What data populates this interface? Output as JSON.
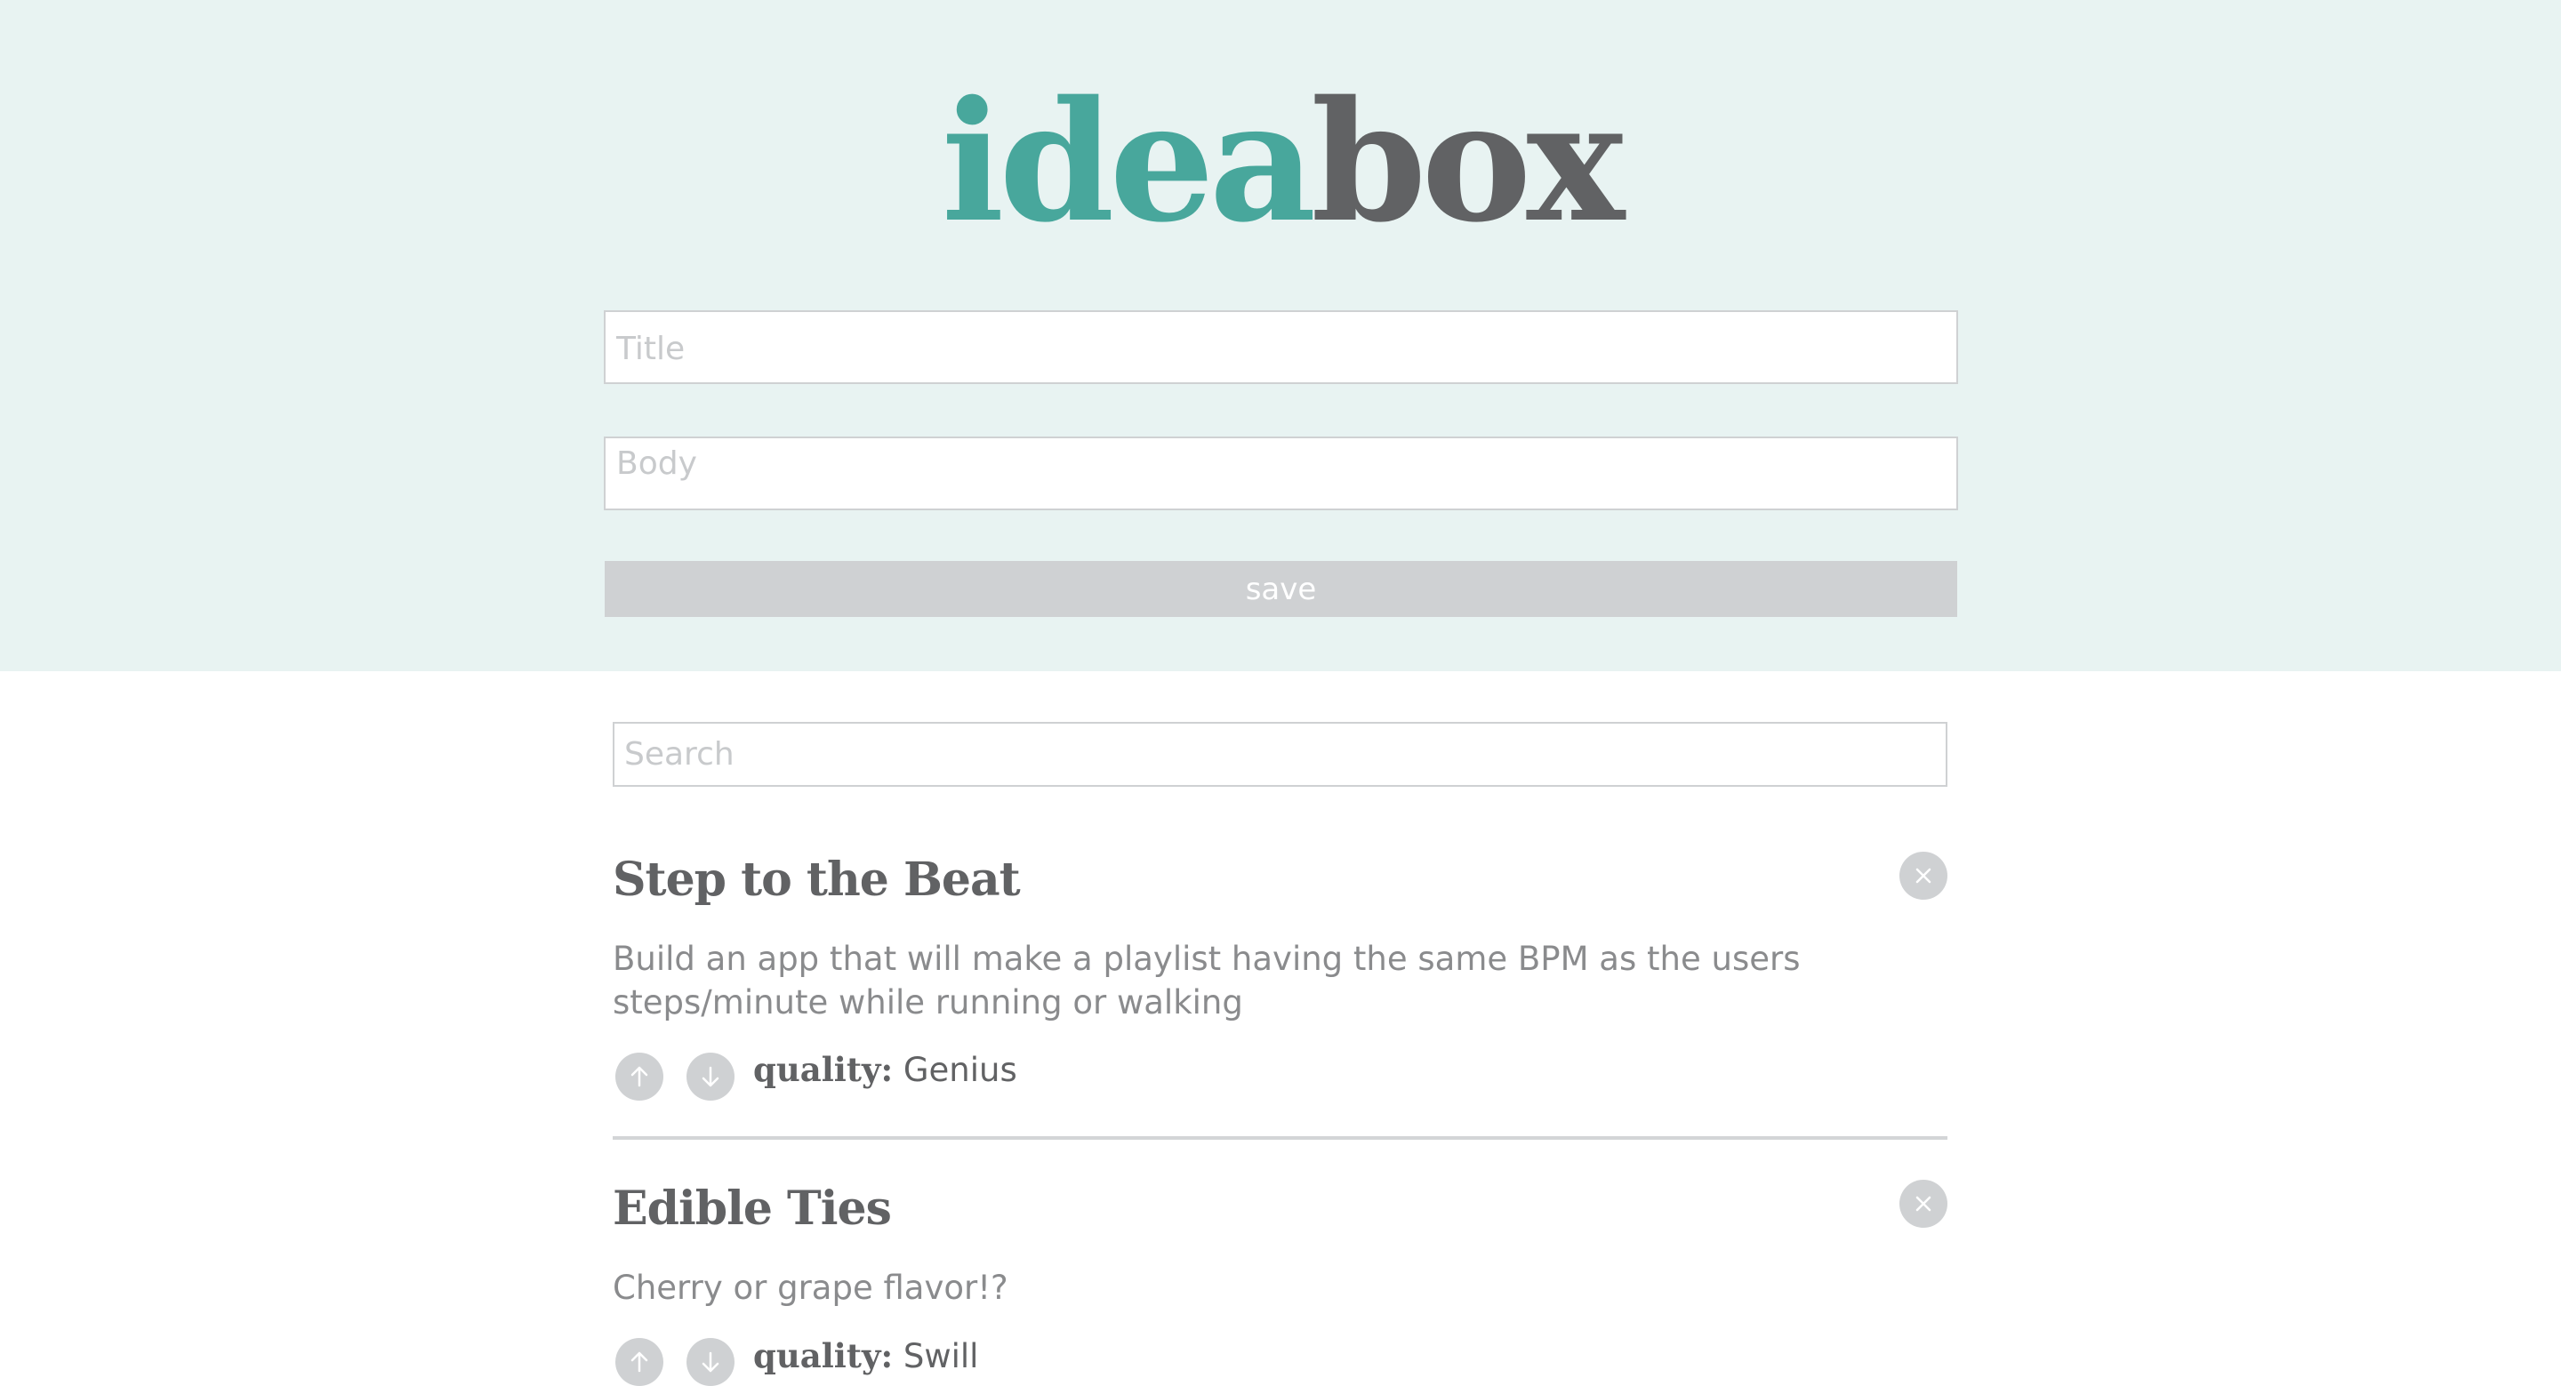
{
  "logo": {
    "part1": "idea",
    "part2": "box"
  },
  "form": {
    "title_placeholder": "Title",
    "body_placeholder": "Body",
    "save_label": "save"
  },
  "search": {
    "placeholder": "Search"
  },
  "ideas": [
    {
      "title": "Step to the Beat",
      "body": "Build an app that will make a playlist having the same BPM as the users steps/minute while running or walking",
      "quality_label": "quality:",
      "quality_value": "Genius"
    },
    {
      "title": "Edible Ties",
      "body": "Cherry or grape flavor!?",
      "quality_label": "quality:",
      "quality_value": "Swill"
    }
  ],
  "icons": {
    "delete": "close-icon",
    "upvote": "arrow-up-icon",
    "downvote": "arrow-down-icon"
  },
  "colors": {
    "header_bg": "#e8f3f2",
    "accent": "#48a79c",
    "dark_gray": "#616264",
    "light_gray": "#cfd1d3"
  }
}
